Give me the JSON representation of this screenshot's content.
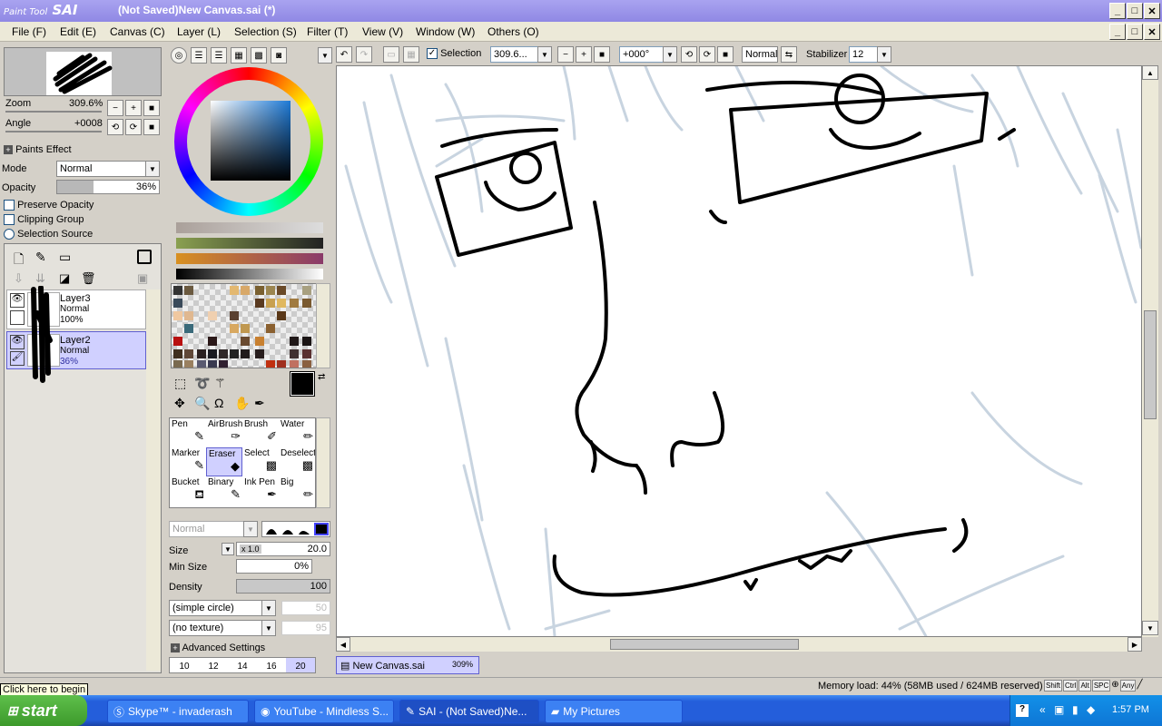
{
  "app": {
    "logo_top": "Paint Tool",
    "logo_main": "SAI",
    "window_title": "(Not Saved)New Canvas.sai (*)"
  },
  "menus": [
    "File (F)",
    "Edit (E)",
    "Canvas (C)",
    "Layer (L)",
    "Selection (S)",
    "Filter (T)",
    "View (V)",
    "Window (W)",
    "Others (O)"
  ],
  "toolbar": {
    "selection_label": "Selection",
    "zoom_value": "309.6...",
    "angle_value": "+000°",
    "blend_value": "Normal",
    "stabilizer_label": "Stabilizer",
    "stabilizer_value": "12"
  },
  "navigator": {
    "zoom_label": "Zoom",
    "zoom_value": "309.6%",
    "angle_label": "Angle",
    "angle_value": "+0008"
  },
  "layer_props": {
    "paints_effect": "Paints Effect",
    "mode_label": "Mode",
    "mode_value": "Normal",
    "opacity_label": "Opacity",
    "opacity_value": "36%",
    "opacity_fraction": 0.36,
    "preserve_opacity": "Preserve Opacity",
    "clipping_group": "Clipping Group",
    "selection_source": "Selection Source"
  },
  "layers": [
    {
      "name": "Layer3",
      "mode": "Normal",
      "opacity": "100%"
    },
    {
      "name": "Layer2",
      "mode": "Normal",
      "opacity": "36%"
    }
  ],
  "tools": [
    {
      "label": "Pen"
    },
    {
      "label": "AirBrush"
    },
    {
      "label": "Brush"
    },
    {
      "label": "Water"
    },
    {
      "label": "Marker"
    },
    {
      "label": "Eraser"
    },
    {
      "label": "Select"
    },
    {
      "label": "Deselect"
    },
    {
      "label": "Bucket"
    },
    {
      "label": "Binary"
    },
    {
      "label": "Ink Pen"
    },
    {
      "label": "Big"
    }
  ],
  "brush": {
    "mode_value": "Normal",
    "size_label": "Size",
    "size_mult": "x 1.0",
    "size_value": "20.0",
    "min_size_label": "Min Size",
    "min_size_value": "0%",
    "density_label": "Density",
    "density_value": "100",
    "shape_value": "(simple circle)",
    "shape_num": "50",
    "texture_value": "(no texture)",
    "texture_num": "95",
    "advanced_label": "Advanced Settings",
    "presets": [
      "10",
      "12",
      "14",
      "16",
      "20"
    ]
  },
  "doc_tab": {
    "name": "New Canvas.sai",
    "zoom": "309%"
  },
  "status": {
    "tooltip": "Click here to begin",
    "memory": "Memory load: 44% (58MB used / 624MB reserved)",
    "keys": [
      "Shift",
      "Ctrl",
      "Alt",
      "SPC",
      "Any"
    ]
  },
  "taskbar": {
    "start_label": "start",
    "items": [
      "Skype™ - invaderash",
      "YouTube - Mindless S...",
      "SAI - (Not Saved)Ne...",
      "My Pictures"
    ],
    "clock": "1:57 PM"
  },
  "colors": {
    "accent": "#8f88e4",
    "taskbar": "#245edb",
    "selected_layer": "#d0d0ff",
    "canvas_sketch": "#c8d4e0"
  }
}
